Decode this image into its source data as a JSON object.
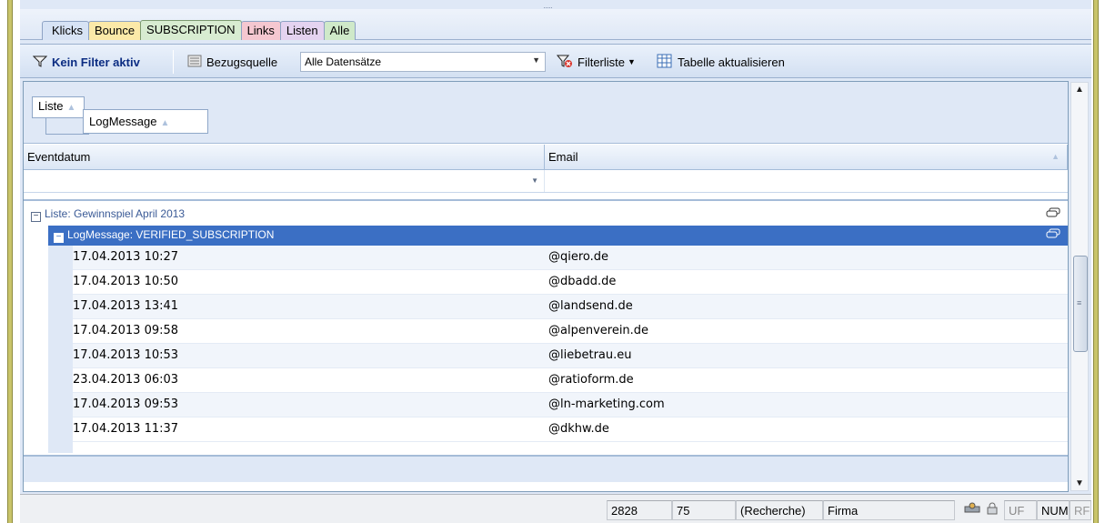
{
  "tabs": [
    "Klicks",
    "Bounce",
    "SUBSCRIPTION",
    "Links",
    "Listen",
    "Alle"
  ],
  "toolbar": {
    "filter_label": "Kein Filter aktiv",
    "source_label": "Bezugsquelle",
    "source_value": "Alle Datensätze",
    "filterlist_label": "Filterliste",
    "refresh_label": "Tabelle aktualisieren"
  },
  "grouping": {
    "level1": "Liste",
    "level2": "LogMessage"
  },
  "columns": {
    "date": "Eventdatum",
    "email": "Email"
  },
  "groups": {
    "list_header": "Liste: Gewinnspiel April 2013",
    "message_header": "LogMessage: VERIFIED_SUBSCRIPTION"
  },
  "rows": [
    {
      "date": "17.04.2013 10:27",
      "email": "@qiero.de"
    },
    {
      "date": "17.04.2013 10:50",
      "email": "@dbadd.de"
    },
    {
      "date": "17.04.2013 13:41",
      "email": "@landsend.de"
    },
    {
      "date": "17.04.2013 09:58",
      "email": "@alpenverein.de"
    },
    {
      "date": "17.04.2013 10:53",
      "email": "@liebetrau.eu"
    },
    {
      "date": "23.04.2013 06:03",
      "email": "@ratioform.de"
    },
    {
      "date": "17.04.2013 09:53",
      "email": "@ln-marketing.com"
    },
    {
      "date": "17.04.2013 11:37",
      "email": "@dkhw.de"
    }
  ],
  "statusbar": {
    "count1": "2828",
    "count2": "75",
    "mode": "(Recherche)",
    "company": "Firma",
    "uf": "UF",
    "num": "NUM",
    "rf": "RF"
  },
  "colors": {
    "selected_group": "#3b6fc4",
    "app_background": "#dfe8f6",
    "frame_accent": "#c9c46a"
  }
}
